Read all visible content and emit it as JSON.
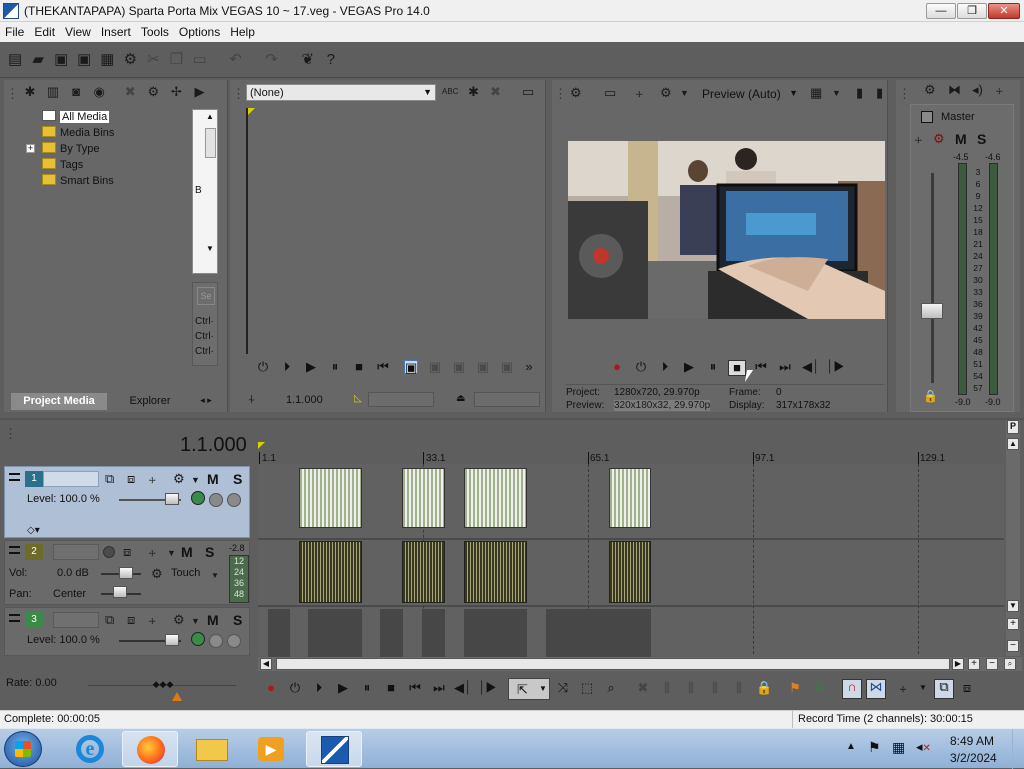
{
  "window": {
    "title": "(THEKANTAPAPA) Sparta Porta Mix VEGAS 10 ~ 17.veg - VEGAS Pro 14.0",
    "minimize": "—",
    "maximize": "❐",
    "close": "✕"
  },
  "menu": [
    "File",
    "Edit",
    "View",
    "Insert",
    "Tools",
    "Options",
    "Help"
  ],
  "project_media": {
    "tree": [
      "All Media",
      "Media Bins",
      "By Type",
      "Tags",
      "Smart Bins"
    ],
    "expander": "+",
    "tabs": [
      "Project Media",
      "Explorer"
    ],
    "side_letter": "B",
    "ctrl_labels": [
      "Ctrl·",
      "Ctrl·",
      "Ctrl·"
    ]
  },
  "trimmer": {
    "dropdown_value": "(None)",
    "timecode": "1.1.000"
  },
  "preview": {
    "mode": "Preview (Auto)",
    "project_label": "Project:",
    "project_value": "1280x720, 29.970p",
    "preview_label": "Preview:",
    "preview_value": "320x180x32, 29.970p",
    "frame_label": "Frame:",
    "frame_value": "0",
    "display_label": "Display:",
    "display_value": "317x178x32"
  },
  "master": {
    "label": "Master",
    "m": "M",
    "s": "S",
    "peak_left": "-4.5",
    "peak_right": "-4.6",
    "scale": [
      "3",
      "6",
      "9",
      "12",
      "15",
      "18",
      "21",
      "24",
      "27",
      "30",
      "33",
      "36",
      "39",
      "42",
      "45",
      "48",
      "51",
      "54",
      "57"
    ],
    "bottom_left": "-9.0",
    "bottom_right": "-9.0"
  },
  "timeline": {
    "cursor": "1.1.000",
    "ruler": [
      "1.1",
      "33.1",
      "65.1",
      "97.1",
      "129.1"
    ],
    "tracks": [
      {
        "num": "1",
        "level_label": "Level: 100.0 %",
        "m": "M",
        "s": "S"
      },
      {
        "num": "2",
        "vol_label": "Vol:",
        "vol_value": "0.0 dB",
        "pan_label": "Pan:",
        "pan_value": "Center",
        "mode": "Touch",
        "meter_top": "-2.8",
        "meter_scale": [
          "12",
          "24",
          "36",
          "48"
        ],
        "m": "M",
        "s": "S"
      },
      {
        "num": "3",
        "level_label": "Level: 100.0 %",
        "m": "M",
        "s": "S"
      }
    ]
  },
  "rate": "Rate: 0.00",
  "status": {
    "left": "Complete: 00:00:05",
    "right": "Record Time (2 channels): 30:00:15"
  },
  "taskbar": {
    "time": "8:49 AM",
    "date": "3/2/2024"
  }
}
